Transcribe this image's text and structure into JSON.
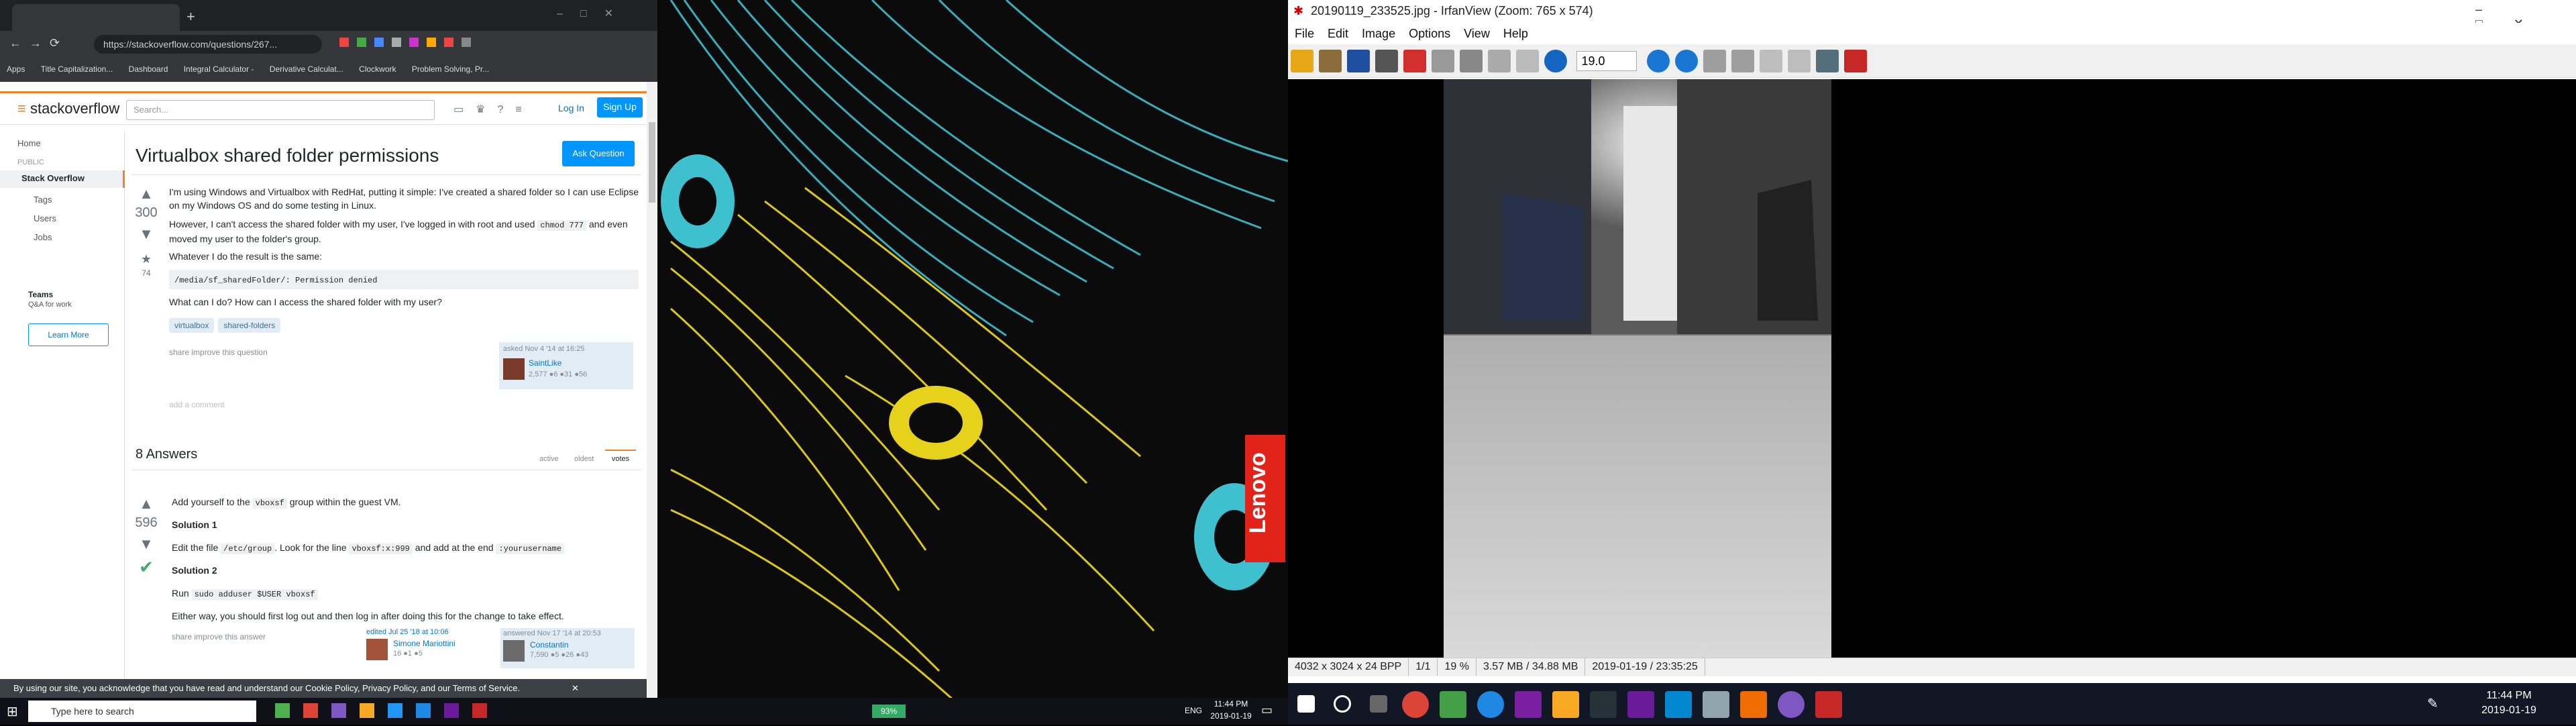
{
  "chrome": {
    "tab_title": "",
    "url": "https://stackoverflow.com/questions/267...",
    "bookmarks": [
      "Apps",
      "Title Capitalization...",
      "Dashboard",
      "Integral Calculator -",
      "Derivative Calculat...",
      "Clockwork",
      "Problem Solving, Pr..."
    ]
  },
  "so": {
    "logo": "stackoverflow",
    "search_placeholder": "Search...",
    "login": "Log In",
    "signup": "Sign Up",
    "side": {
      "home": "Home",
      "public": "PUBLIC",
      "stackoverflow": "Stack Overflow",
      "tags": "Tags",
      "users": "Users",
      "jobs": "Jobs",
      "teams": "Teams",
      "teams_sub": "Q&A for work",
      "learn_more": "Learn More"
    },
    "question": {
      "title": "Virtualbox shared folder permissions",
      "ask": "Ask Question",
      "votes": "300",
      "favorites": "74",
      "p1": "I'm using Windows and Virtualbox with RedHat, putting it simple: I've created a shared folder so I can use Eclipse on my Windows OS and do some testing in Linux.",
      "p2a": "However, I can't access the shared folder with my user, I've logged in with root and used",
      "p2code": "chmod 777",
      "p2b": "and even moved my user to the folder's group.",
      "p3": "Whatever I do the result is the same:",
      "code": "/media/sf_sharedFolder/: Permission denied",
      "p4": "What can I do? How can I access the shared folder with my user?",
      "tags": [
        "virtualbox",
        "shared-folders"
      ],
      "share": "share  improve this question",
      "asked": "asked Nov 4 '14 at 16:25",
      "user": "SaintLike",
      "rep": "2,577 ●6 ●31 ●56",
      "comment": "add a comment"
    },
    "answers": {
      "count": "8 Answers",
      "sort": [
        "active",
        "oldest",
        "votes"
      ],
      "votes": "596",
      "a1a": "Add yourself to the",
      "a1code": "vboxsf",
      "a1b": "group within the guest VM.",
      "s1": "Solution 1",
      "s1a": "Edit the file",
      "s1code1": "/etc/group",
      "s1b": ". Look for the line",
      "s1code2": "vboxsf:x:999",
      "s1c": "and add at the end",
      "s1code3": ":yourusername",
      "s2": "Solution 2",
      "s2a": "Run",
      "s2code": "sudo adduser $USER vboxsf",
      "either": "Either way, you should first log out and then log in after doing this for the change to take effect.",
      "share": "share  improve this answer",
      "edited": "edited Jul 25 '18 at 10:06",
      "editor": "Simone Mariottini",
      "editor_rep": "16 ●1 ●5",
      "answered": "answered Nov 17 '14 at 20:53",
      "answerer": "Constantin",
      "answerer_rep": "7,590 ●5 ●26 ●43"
    },
    "cookie": "By using our site, you acknowledge that you have read and understand our Cookie Policy, Privacy Policy, and our Terms of Service.",
    "cookie_close": "✕"
  },
  "lenovo": "Lenovo",
  "irfan": {
    "title": "20190119_233525.jpg - IrfanView (Zoom: 765 x 574)",
    "menu": [
      "File",
      "Edit",
      "Image",
      "Options",
      "View",
      "Help"
    ],
    "zoom": "19.0",
    "status": [
      "4032 x 3024 x 24 BPP",
      "1/1",
      "19 %",
      "3.57 MB / 34.88 MB",
      "2019-01-19 / 23:35:25"
    ]
  },
  "taskbar_left": {
    "search": "Type here to search",
    "time": "11:44 PM",
    "date": "2019-01-19",
    "lang": "ENG",
    "battery": "93%"
  },
  "taskbar_right": {
    "time": "11:44 PM",
    "date": "2019-01-19"
  }
}
